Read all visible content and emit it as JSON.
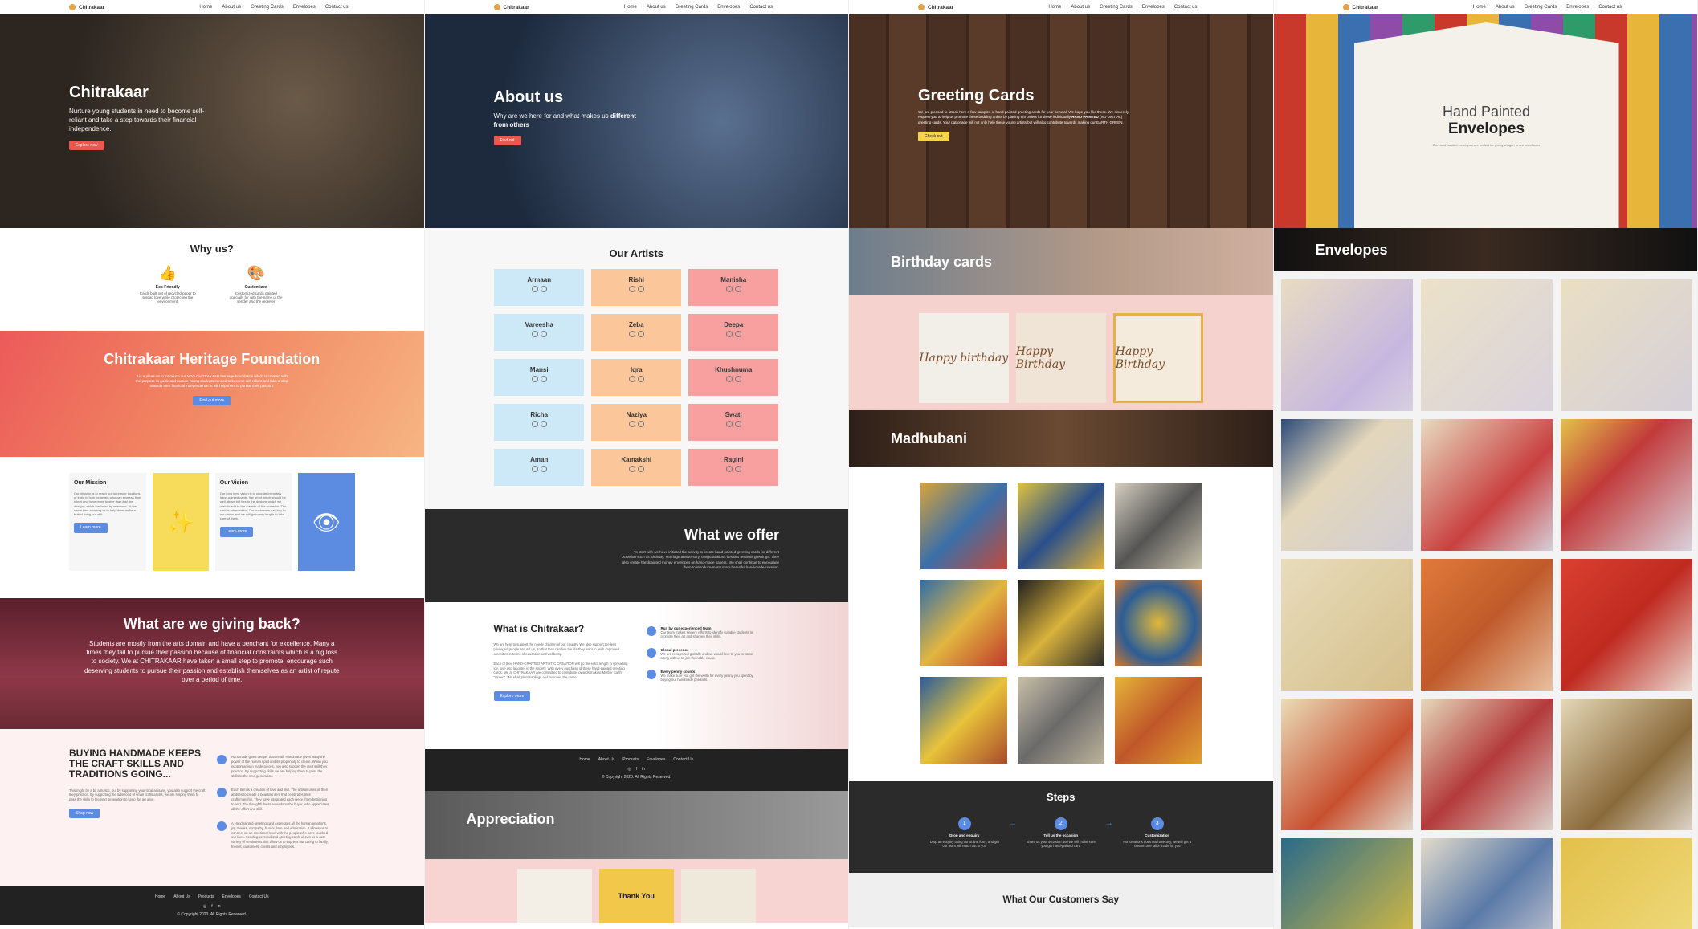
{
  "nav": {
    "brand": "Chitrakaar",
    "links": [
      "Home",
      "About us",
      "Greeting Cards",
      "Envelopes",
      "Contact us"
    ]
  },
  "home": {
    "hero": {
      "title": "Chitrakaar",
      "text": "Nurture young students in need to become self-reliant and take a step towards their financial independence.",
      "button": "Explore now"
    },
    "why": {
      "title": "Why us?",
      "items": [
        {
          "title": "Eco Friendly",
          "text": "Cards built out of recycled paper to spread love while protecting the environment",
          "icon": "thumbs-up-icon"
        },
        {
          "title": "Customized",
          "text": "Customized cards painted specially for with the name of the sender and the receiver",
          "icon": "palette-icon"
        }
      ]
    },
    "foundation": {
      "title": "Chitrakaar Heritage Foundation",
      "text": "It is a pleasure to introduce our NGO CHITRAKAAR Heritage Foundation which is created with the purpose to guide and nurture young students in need to become self reliant and take a step towards their financial independence. It will help them to pursue their passion.",
      "button": "Find out more"
    },
    "mission": {
      "title": "Our Mission",
      "text": "Our mission is to reach out to remote locations of India to look for artists who can express their talent and have more to give than just the designs which are loved by everyone. At the same time allowing us to help them make a fruitful living out of it.",
      "button": "Learn more"
    },
    "vision": {
      "title": "Our Vision",
      "text": "Our long term vision is to provide intimately hand-painted cards, the art of which should be well above but ties to the designs which we wish to add to the warmth of the occasion. The card is intended for. Our customers can buy to our vision and we will go to any length to take care of them.",
      "button": "Learn more"
    },
    "giving": {
      "title": "What are we giving back?",
      "text": "Students are mostly from the arts domain and have a penchant for excellence. Many a times they fail to pursue their passion because of financial constraints which is a big loss to society. We at CHITRAKAAR have taken a small step to promote, encourage such deserving students to pursue their passion and establish themselves as an artist of repute over a period of time."
    },
    "buying": {
      "title": "BUYING HANDMADE KEEPS THE CRAFT SKILLS AND TRADITIONS GOING...",
      "text": "This might be a bit altruistic, but by supporting your local artisans, you also support the craft they practice. By supporting the livelihood of small crafts artists, we are helping them to pass the skills to the next generation to keep the art alive.",
      "button": "Shop now",
      "points": [
        "Handmade gives deeper than retail. Handmade gives away the power of the human spirit and its propensity to create. When you support artisan made pieces, you also support the craft skill they practice. By supporting skills we are helping them to pass the skills to the next generation.",
        "Each item is a creation of love and skill. The artisan uses all their abilities to create a beautiful item that celebrates their craftsmanship. They have integrated each piece, from beginning to end. The thoughtfulness extends to the buyer, who appreciates all the effort and skill.",
        "A Handpainted greeting card expresses all the human emotions, joy, thanks, sympathy, humor, love and admiration. It allows us to connect on an emotional level with the people who have touched our lives. Sending personalized greeting cards allows us a vast variety of sentiments that allow us to express our caring to family, friends, customers, clients and employees."
      ]
    },
    "footer": {
      "links": [
        "Home",
        "About Us",
        "Products",
        "Envelopes",
        "Contact Us"
      ],
      "copyright": "© Copyright 2023. All Rights Reserved."
    }
  },
  "about": {
    "hero": {
      "title": "About us",
      "text_plain": "Why are we here for and what makes us",
      "text_bold": "different from others",
      "button": "Find out"
    },
    "artists_title": "Our Artists",
    "artists": [
      "Armaan",
      "Rishi",
      "Manisha",
      "Vareesha",
      "Zeba",
      "Deepa",
      "Mansi",
      "Iqra",
      "Khushnuma",
      "Richa",
      "Naziya",
      "Swati",
      "Aman",
      "Kamakshi",
      "Ragini"
    ],
    "offer": {
      "title": "What we offer",
      "text": "To start with we have initiated the activity to create hand painted greeting cards for different occasion such as Birthday, Marriage anniversary, congratulations besides festivals greetings. They also create handpainted money envelopes on hand-made papers. We shall continue to encourage them to introduce many more beautiful hand-made creation."
    },
    "what": {
      "title": "What is Chitrakaar?",
      "text1": "We are here to support the needy children of our country. We also support the less privileged people around us, so that they can live the life they want to, with improved amenities in terms of education and wellbeing.",
      "text2": "Each of their HAND-CRAFTED ARTISTIC CREATION will go the extra length in spreading joy, love and laughter in the society. With every purchase of these hand-painted greeting cards, We at CHITRAKAAR are committed to contribute towards making Mother Earth \"Green\". We shall plant saplings and maintain the same.",
      "button": "Explore more",
      "points": [
        {
          "title": "Run by our experienced team",
          "text": "Our team makes sincere efforts to identify suitable students to promote their art and sharpen their skills."
        },
        {
          "title": "Global presence",
          "text": "We are recognized globally and we would love to you to come along with us to join the noble cause."
        },
        {
          "title": "Every penny counts",
          "text": "We make sure you get the worth for every penny you spent by buying our handmade products."
        }
      ]
    },
    "footer": {
      "links": [
        "Home",
        "About Us",
        "Products",
        "Envelopes",
        "Contact Us"
      ],
      "copyright": "© Copyright 2023. All Rights Reserved."
    },
    "appreciation": "Appreciation",
    "appr_cards": [
      "",
      "Thank You",
      ""
    ]
  },
  "greeting": {
    "hero": {
      "title": "Greeting Cards",
      "text_pre": "We are pleased to attach here a few samples of hand painted greeting cards for your perusal. We hope you like these. We sincerely request you to help us promote these budding artists by placing 8/8 orders for these individually",
      "text_bold": "HAND PAINTED",
      "text_post": "(NO DIGITAL) greeting cards. Your patronage will not only help these young artists but will also contribute towards making our EARTH GREEN.",
      "button": "Check out"
    },
    "birthday": "Birthday cards",
    "birthday_cards": [
      "Happy birthday",
      "Happy Birthday",
      "Happy Birthday"
    ],
    "madhubani": "Madhubani",
    "steps": {
      "title": "Steps",
      "items": [
        {
          "num": "1",
          "title": "Drop and enquiry",
          "text": "Drop an enquiry using our online form, and get our team will reach out to you"
        },
        {
          "num": "2",
          "title": "Tell us the occasion",
          "text": "Share us your occasion and we will make sure you get hand-painted card"
        },
        {
          "num": "3",
          "title": "Customization",
          "text": "For creations does not have any, we will get a custom one tailor made for you"
        }
      ]
    },
    "customers": "What Our Customers Say"
  },
  "envelopes": {
    "hero": {
      "line1": "Hand Painted",
      "line2": "Envelopes",
      "text": "Our hand painted envelopes are perfect for giving shagun to our loved ones"
    },
    "banner": "Envelopes"
  },
  "colors": {
    "accent_blue": "#5b8ce2",
    "accent_red": "#e85a4f",
    "accent_yellow": "#f6d44a",
    "dark": "#2b2b2b"
  }
}
